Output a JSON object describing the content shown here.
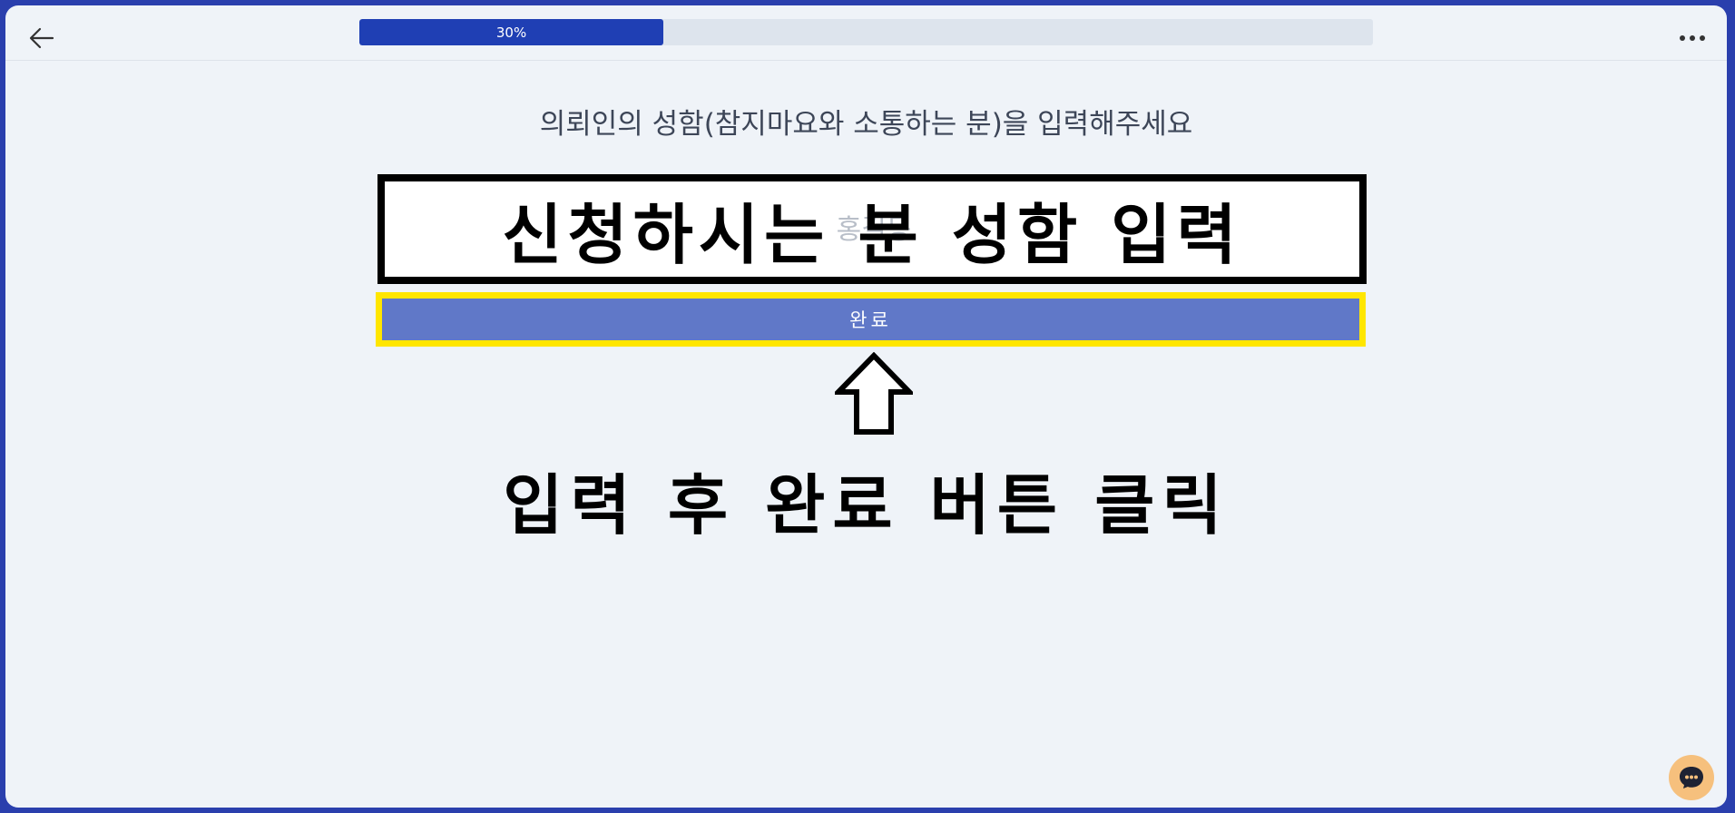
{
  "progress": {
    "label": "30%",
    "value": 0.3
  },
  "question": {
    "text": "의뢰인의 성함(참지마요와 소통하는 분)을 입력해주세요"
  },
  "name_input": {
    "placeholder": "홍길동",
    "value": "",
    "overlay_text": "신청하시는 분 성함 입력"
  },
  "submit": {
    "label": "완료"
  },
  "instruction": {
    "text": "입력 후 완료 버튼 클릭"
  },
  "colors": {
    "accent": "#1f3fb4",
    "button": "#6078c8",
    "highlight": "#ffe600",
    "chat_button": "#f6c07d"
  },
  "icons": {
    "back": "arrow-left-icon",
    "more": "more-horizontal-icon",
    "arrow": "up-arrow-icon",
    "chat": "chat-bubble-icon"
  }
}
